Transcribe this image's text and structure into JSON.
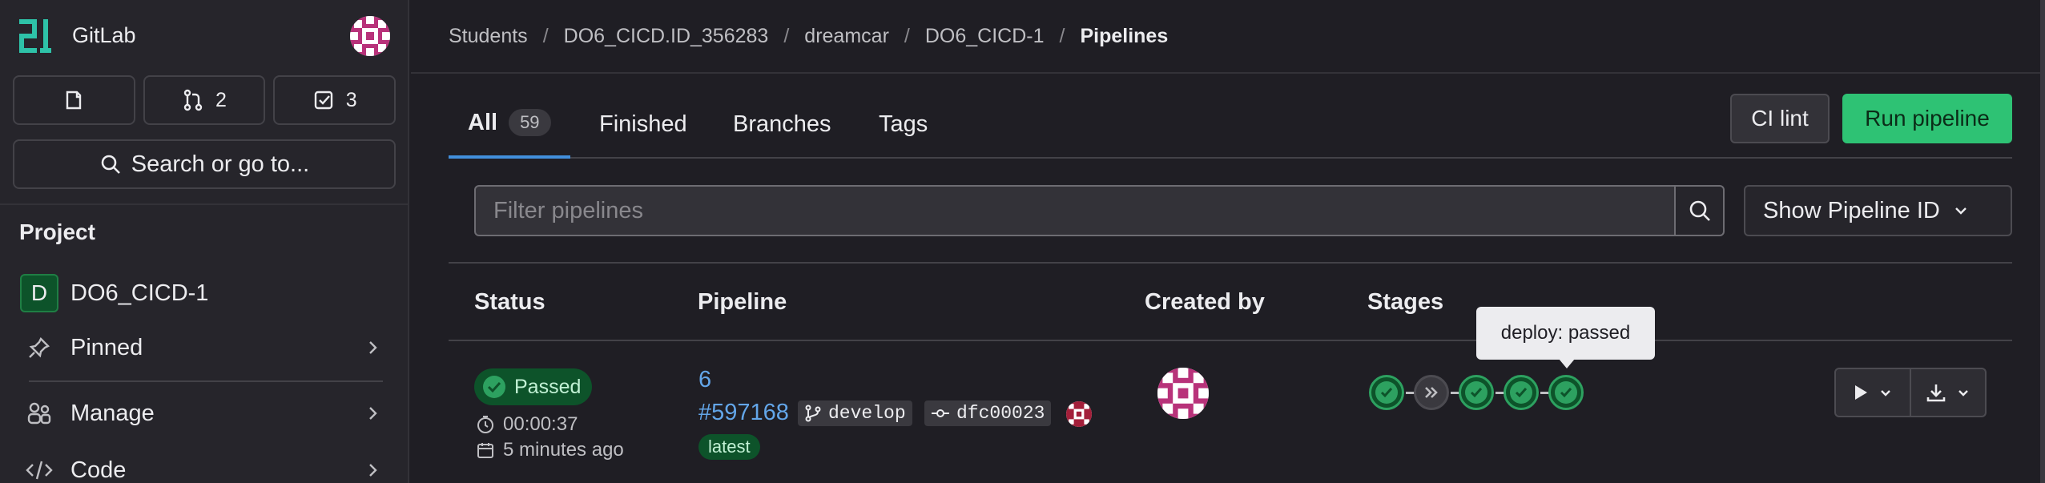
{
  "app": {
    "name": "GitLab"
  },
  "sidebar": {
    "buttons": [
      {
        "icon": "issues-icon",
        "count": ""
      },
      {
        "icon": "merge-request-icon",
        "count": "2"
      },
      {
        "icon": "todo-icon",
        "count": "3"
      }
    ],
    "search_label": "Search or go to...",
    "section_title": "Project",
    "project_initial": "D",
    "project_name": "DO6_CICD-1",
    "items": [
      {
        "label": "Pinned",
        "icon": "pin-icon"
      },
      {
        "label": "Manage",
        "icon": "users-icon"
      },
      {
        "label": "Code",
        "icon": "code-icon"
      }
    ]
  },
  "breadcrumb": [
    "Students",
    "DO6_CICD.ID_356283",
    "dreamcar",
    "DO6_CICD-1",
    "Pipelines"
  ],
  "tabs": [
    {
      "label": "All",
      "count": "59"
    },
    {
      "label": "Finished"
    },
    {
      "label": "Branches"
    },
    {
      "label": "Tags"
    }
  ],
  "buttons": {
    "ci_lint": "CI lint",
    "run_pipeline": "Run pipeline"
  },
  "filter": {
    "placeholder": "Filter pipelines",
    "show_id": "Show Pipeline ID"
  },
  "table": {
    "headers": [
      "Status",
      "Pipeline",
      "Created by",
      "Stages"
    ],
    "rows": [
      {
        "status": "Passed",
        "duration": "00:00:37",
        "finished": "5 minutes ago",
        "pipeline_number": "6",
        "pipeline_id": "#597168",
        "branch": "develop",
        "commit": "dfc00023",
        "tag": "latest",
        "stages": [
          "success",
          "skipped",
          "success",
          "success",
          "success"
        ]
      }
    ]
  },
  "tooltip": "deploy: passed",
  "colors": {
    "accent": "#428fdc",
    "success": "#2da160",
    "run_button": "#2ec274"
  }
}
